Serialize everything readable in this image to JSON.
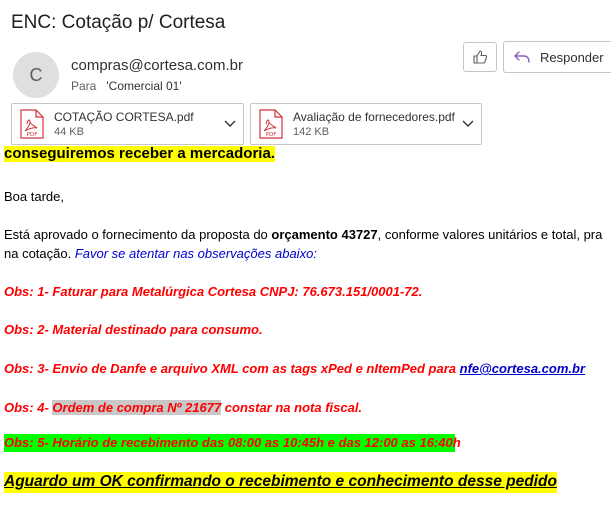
{
  "email": {
    "subject": "ENC: Cotação p/ Cortesa",
    "avatar_initial": "C",
    "sender": "compras@cortesa.com.br",
    "to_label": "Para",
    "to_name": "'Comercial 01'"
  },
  "actions": {
    "reply_label": "Responder",
    "like_icon": "thumbs-up-icon",
    "reply_icon": "reply-arrow-icon"
  },
  "attachments": [
    {
      "name": "COTAÇÃO CORTESA.pdf",
      "size": "44 KB",
      "icon": "pdf-icon",
      "badge": "PDF"
    },
    {
      "name": "Avaliação de fornecedores.pdf",
      "size": "142 KB",
      "icon": "pdf-icon",
      "badge": "PDF"
    }
  ],
  "body": {
    "cut_heading": "conseguiremos receber a mercadoria.",
    "greeting": "Boa tarde,",
    "p1_a": "Está aprovado o fornecimento da proposta do ",
    "p1_b": "orçamento 43727",
    "p1_c": ", conforme valores unitários e total, pra",
    "p2_a": "na cotação. ",
    "p2_b": "Favor se atentar nas observações abaixo:",
    "obs1": "Obs: 1- Faturar para Metalúrgica Cortesa CNPJ: 76.673.151/0001-72.",
    "obs2": "Obs: 2- Material destinado para consumo.",
    "obs3": "Obs: 3- Envio de Danfe e arquivo XML com as tags xPed e nItemPed para ",
    "obs3_link": "nfe@cortesa.com.br",
    "obs4_a": "Obs: 4- ",
    "obs4_b": "Ordem de compra Nº 21677",
    "obs4_c": " constar na nota fiscal.",
    "obs5": "Obs: 5- Horário de recebimento das 08:00 as 10:45h e das 12:00 as 16:40h",
    "closing": "Aguardo um OK confirmando o recebimento e conhecimento desse pedido"
  },
  "colors": {
    "highlight_yellow": "#ffff00",
    "highlight_green": "#00ff00",
    "obs_red": "#ff0000",
    "link_blue": "#0000cc",
    "pdf_red": "#d13438"
  }
}
